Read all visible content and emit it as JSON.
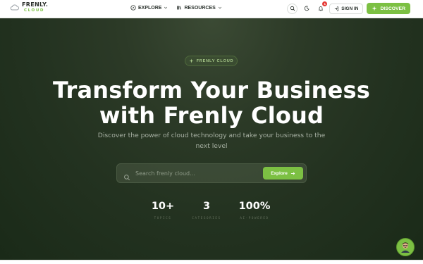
{
  "brand": {
    "name": "FRENLY.",
    "sub": "CLOUD",
    "icon": "cloud-icon"
  },
  "nav": {
    "menu": [
      {
        "label": "EXPLORE",
        "icon": "compass-icon"
      },
      {
        "label": "RESOURCES",
        "icon": "library-icon"
      }
    ],
    "search_icon": "search-icon",
    "theme_icon": "moon-icon",
    "notifications": {
      "icon": "bell-icon",
      "count": "1"
    },
    "signin_label": "SIGN IN",
    "discover_label": "DISCOVER"
  },
  "hero": {
    "pill_label": "FRENLY CLOUD",
    "title_line1": "Transform Your Business",
    "title_line2": "with Frenly Cloud",
    "subtitle": "Discover the power of cloud technology and take your business to the next level",
    "search_placeholder": "Search frenly cloud...",
    "explore_label": "Explore",
    "stats": [
      {
        "value": "10+",
        "label": "TOPICS"
      },
      {
        "value": "3",
        "label": "CATEGORIES"
      },
      {
        "value": "100%",
        "label": "AI-POWERED"
      }
    ]
  },
  "colors": {
    "accent": "#7cc043",
    "hero_dark": "#1c2a1a",
    "nav_bg": "#ffffff",
    "badge": "#e53935"
  }
}
